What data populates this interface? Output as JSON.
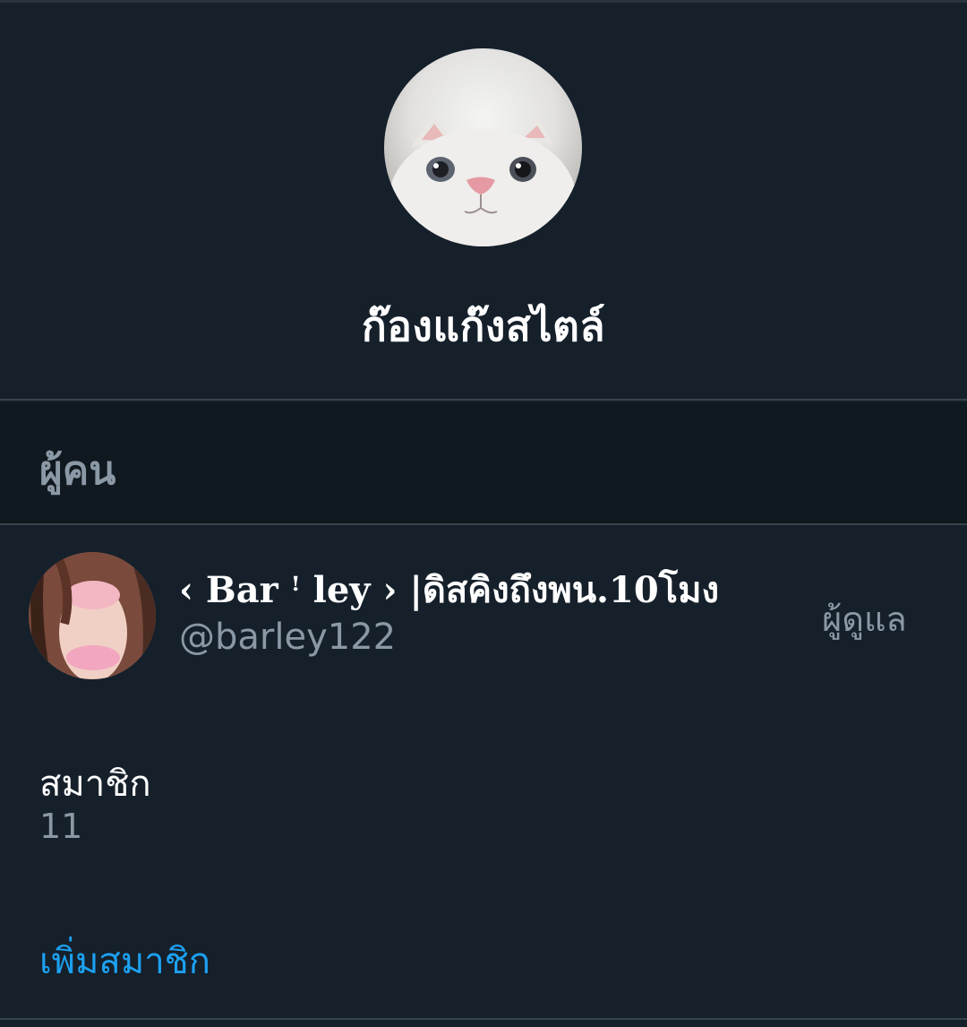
{
  "group": {
    "name": "ก๊องแก๊งสไตล์"
  },
  "people_section": {
    "title": "ผู้คน"
  },
  "member": {
    "display_name": "‹ Bar ꜝ ley › |ดิสคิงถึงพน.10โมง",
    "handle": "@barley122",
    "role": "ผู้ดูแล"
  },
  "members": {
    "label": "สมาชิก",
    "count": "11"
  },
  "actions": {
    "add_member": "เพิ่มสมาชิก"
  },
  "colors": {
    "background": "#15202b",
    "section_header": "#101820",
    "divider": "#38444d",
    "secondary_text": "#8b98a5",
    "accent": "#1da1f2"
  }
}
